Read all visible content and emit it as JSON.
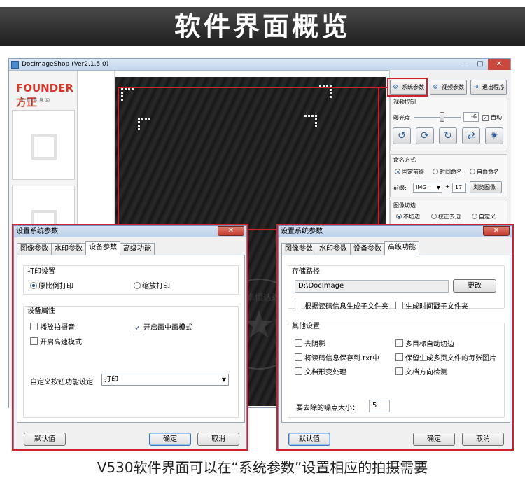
{
  "banner": {
    "title": "软件界面概览"
  },
  "caption": "V530软件界面可以在“系统参数”设置相应的拍摄需要",
  "window": {
    "title": "DocImageShop (Ver2.1.5.0)",
    "controls": {
      "min": "–",
      "max": "□",
      "close": "✕"
    }
  },
  "brand": {
    "logo": "FOUNDER方正",
    "tagline": "正在你身边"
  },
  "toolbar": {
    "system_params": "系统参数",
    "video_params": "视频参数",
    "exit": "退出程序"
  },
  "video_control": {
    "title": "视频控制",
    "exposure_label": "曝光度",
    "exposure_value": "-6",
    "auto_label": "自动"
  },
  "naming": {
    "title": "命名方式",
    "fixed_prefix": "固定前缀",
    "time_name": "时间命名",
    "free_name": "自由命名",
    "prefix_label": "前缀:",
    "prefix_value": "IMG",
    "plus": "+",
    "counter": "17",
    "browse": "浏览图像"
  },
  "cropping": {
    "title": "图像切边",
    "no_crop": "不切边",
    "deskew": "校正去边",
    "custom": "自定义"
  },
  "dialog_left": {
    "title": "设置系统参数",
    "tabs": [
      "图像参数",
      "水印参数",
      "设备参数",
      "高级功能"
    ],
    "print_title": "打印设置",
    "print_proportional": "原比例打印",
    "print_scaled": "缩放打印",
    "device_title": "设备属性",
    "shutter_sound": "播放拍摄音",
    "pip_mode": "开启画中画模式",
    "high_speed": "开启高速模式",
    "custom_button_label": "自定义按钮功能设定",
    "custom_button_value": "打印",
    "default_btn": "默认值",
    "ok_btn": "确定",
    "cancel_btn": "取消"
  },
  "dialog_right": {
    "title": "设置系统参数",
    "tabs": [
      "图像参数",
      "水印参数",
      "设备参数",
      "高级功能"
    ],
    "storage_title": "存储路径",
    "path_value": "D:\\DocImage",
    "change_btn": "更改",
    "subfolder_by_code": "根据读码信息生成子文件夹",
    "timestamp_folder": "生成时间戳子文件夹",
    "other_title": "其他设置",
    "remove_shadow": "去阴影",
    "multi_target_crop": "多目标自动切边",
    "save_code_txt": "将读码信息保存到.txt中",
    "keep_multi_page": "保留生成多页文件的每张图片",
    "deform_process": "文档形变处理",
    "orientation_detect": "文档方向检测",
    "noise_label": "要去除的噪点大小：",
    "noise_value": "5",
    "default_btn": "默认值",
    "ok_btn": "确定",
    "cancel_btn": "取消"
  },
  "watermark_seal": {
    "text": "北京卓恒达数码"
  },
  "colors": {
    "highlight_red": "#d0202a",
    "banner_dark": "#2c2c2c",
    "brand_red": "#d4382b"
  }
}
